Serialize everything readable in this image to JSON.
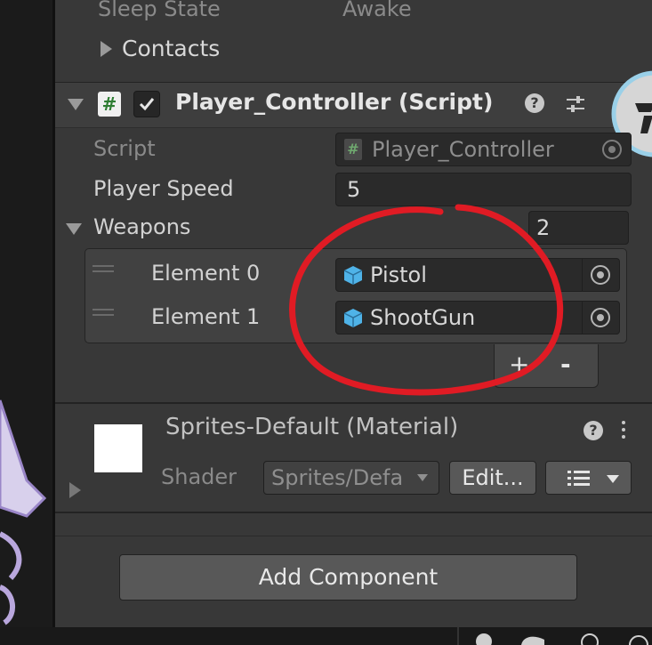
{
  "rigidbody_info": {
    "sleep_state_label": "Sleep State",
    "sleep_state_value": "Awake",
    "contacts_label": "Contacts"
  },
  "player_controller": {
    "component_title": "Player_Controller (Script)",
    "enabled": true,
    "script_label": "Script",
    "script_value": "Player_Controller",
    "player_speed_label": "Player Speed",
    "player_speed_value": "5",
    "weapons_label": "Weapons",
    "weapons_count": "2",
    "elements": [
      {
        "label": "Element 0",
        "value": "Pistol"
      },
      {
        "label": "Element 1",
        "value": "ShootGun"
      }
    ],
    "add_label": "+",
    "remove_label": "-"
  },
  "material": {
    "title": "Sprites-Default (Material)",
    "shader_label": "Shader",
    "shader_value": "Sprites/Defa",
    "edit_label": "Edit..."
  },
  "add_component_label": "Add Component",
  "colors": {
    "annotation_red": "#e01b24",
    "cube_blue": "#4fb3e8",
    "script_icon_green": "#2e7d32"
  }
}
